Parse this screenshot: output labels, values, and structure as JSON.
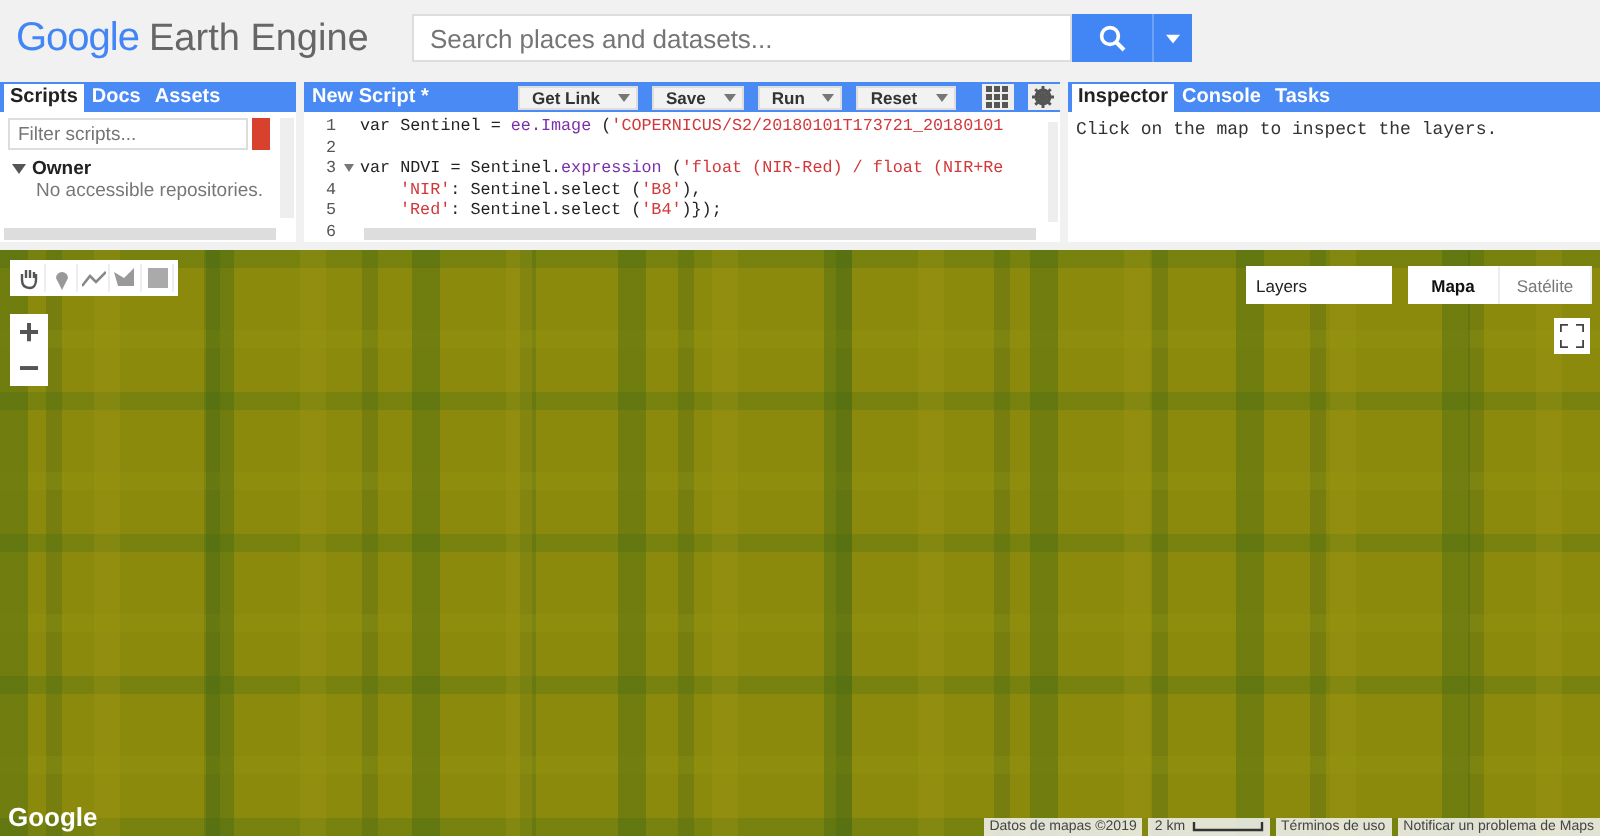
{
  "header": {
    "logo_google": "Google",
    "logo_product": "Earth Engine",
    "search": {
      "placeholder": "Search places and datasets..."
    }
  },
  "left_panel": {
    "tabs": [
      {
        "label": "Scripts",
        "selected": true
      },
      {
        "label": "Docs",
        "selected": false
      },
      {
        "label": "Assets",
        "selected": false
      }
    ],
    "filter": {
      "placeholder": "Filter scripts..."
    },
    "tree": [
      {
        "label": "Owner",
        "expanded": true,
        "children": [
          {
            "label": "No accessible repositories."
          }
        ]
      }
    ]
  },
  "editor": {
    "title": "New Script *",
    "buttons": [
      {
        "label": "Get Link",
        "kind": "split"
      },
      {
        "label": "Save",
        "kind": "split"
      },
      {
        "label": "Run",
        "kind": "split"
      },
      {
        "label": "Reset",
        "kind": "split"
      },
      {
        "kind": "apps"
      },
      {
        "kind": "settings"
      }
    ],
    "lines": [
      {
        "number": "1",
        "foldable": false,
        "tokens": [
          {
            "kind": "plain",
            "text": "var Sentinel = "
          },
          {
            "kind": "fn",
            "text": "ee.Image"
          },
          {
            "kind": "plain",
            "text": " ("
          },
          {
            "kind": "str",
            "text": "'COPERNICUS/S2/20180101T173721_20180101"
          }
        ]
      },
      {
        "number": "2",
        "foldable": false
      },
      {
        "number": "3",
        "foldable": true,
        "tokens": [
          {
            "kind": "plain",
            "text": "var NDVI = Sentinel."
          },
          {
            "kind": "fn",
            "text": "expression"
          },
          {
            "kind": "plain",
            "text": " ("
          },
          {
            "kind": "str",
            "text": "'float (NIR-Red) / float (NIR+Re"
          }
        ]
      },
      {
        "number": "4",
        "foldable": false,
        "indented": true,
        "tokens": [
          {
            "kind": "str",
            "text": "'NIR'"
          },
          {
            "kind": "plain",
            "text": ": Sentinel.select ("
          },
          {
            "kind": "str",
            "text": "'B8'"
          },
          {
            "kind": "plain",
            "text": "),"
          }
        ]
      },
      {
        "number": "5",
        "foldable": false,
        "indented": true,
        "tokens": [
          {
            "kind": "str",
            "text": "'Red'"
          },
          {
            "kind": "plain",
            "text": ": Sentinel.select ("
          },
          {
            "kind": "str",
            "text": "'B4'"
          },
          {
            "kind": "plain",
            "text": ")});"
          }
        ]
      },
      {
        "number": "6",
        "foldable": false
      }
    ]
  },
  "right_panel": {
    "tabs": [
      {
        "label": "Inspector",
        "selected": true
      },
      {
        "label": "Console",
        "selected": false
      },
      {
        "label": "Tasks",
        "selected": false
      }
    ],
    "message": "Click on the map to inspect the layers."
  },
  "map": {
    "tools": [
      {
        "kind": "hand"
      },
      {
        "kind": "marker"
      },
      {
        "kind": "line"
      },
      {
        "kind": "polygon"
      },
      {
        "kind": "rectangle"
      }
    ],
    "layers_label": "Layers",
    "map_types": [
      {
        "label": "Mapa",
        "selected": true
      },
      {
        "label": "Satélite",
        "selected": false
      }
    ],
    "zoom_in": "+",
    "zoom_out": "−",
    "logo": "Google",
    "attribution": [
      "Datos de mapas ©2019",
      "2 km",
      "Términos de uso",
      "Notificar un problema de Maps"
    ]
  }
}
